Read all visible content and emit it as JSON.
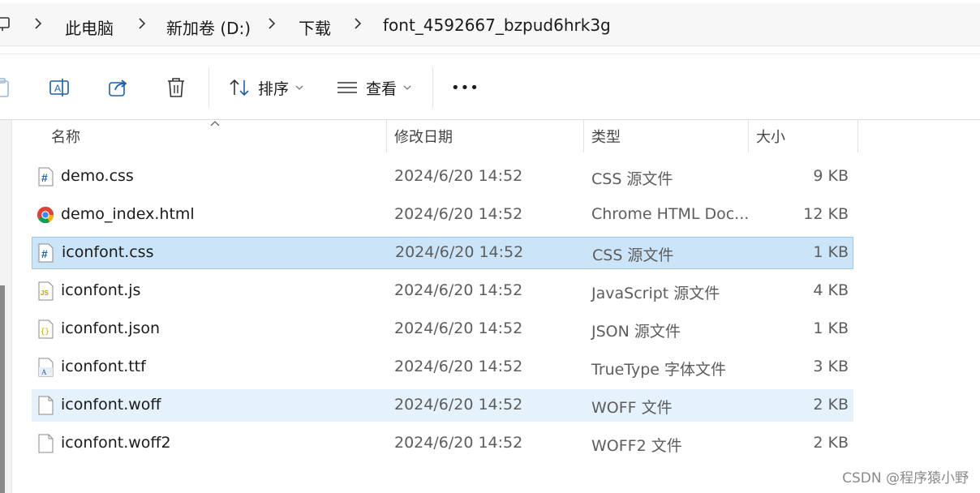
{
  "breadcrumb": {
    "items": [
      "此电脑",
      "新加卷 (D:)",
      "下载",
      "font_4592667_bzpud6hrk3g"
    ]
  },
  "toolbar": {
    "sort_label": "排序",
    "view_label": "查看",
    "more_label": "•••"
  },
  "columns": {
    "name": "名称",
    "modified": "修改日期",
    "type": "类型",
    "size": "大小"
  },
  "files": [
    {
      "name": "demo.css",
      "modified": "2024/6/20 14:52",
      "type": "CSS 源文件",
      "size": "9 KB",
      "icon": "css-file-icon"
    },
    {
      "name": "demo_index.html",
      "modified": "2024/6/20 14:52",
      "type": "Chrome HTML Doc...",
      "size": "12 KB",
      "icon": "chrome-icon"
    },
    {
      "name": "iconfont.css",
      "modified": "2024/6/20 14:52",
      "type": "CSS 源文件",
      "size": "1 KB",
      "icon": "css-file-icon"
    },
    {
      "name": "iconfont.js",
      "modified": "2024/6/20 14:52",
      "type": "JavaScript 源文件",
      "size": "4 KB",
      "icon": "js-file-icon"
    },
    {
      "name": "iconfont.json",
      "modified": "2024/6/20 14:52",
      "type": "JSON 源文件",
      "size": "1 KB",
      "icon": "json-file-icon"
    },
    {
      "name": "iconfont.ttf",
      "modified": "2024/6/20 14:52",
      "type": "TrueType 字体文件",
      "size": "3 KB",
      "icon": "font-file-icon"
    },
    {
      "name": "iconfont.woff",
      "modified": "2024/6/20 14:52",
      "type": "WOFF 文件",
      "size": "2 KB",
      "icon": "blank-file-icon"
    },
    {
      "name": "iconfont.woff2",
      "modified": "2024/6/20 14:52",
      "type": "WOFF2 文件",
      "size": "2 KB",
      "icon": "blank-file-icon"
    }
  ],
  "watermark": "CSDN @程序猿小野",
  "colors": {
    "selected_bg": "#cce4f7",
    "hover_bg": "#e5f1fb",
    "accent": "#0067c0"
  }
}
